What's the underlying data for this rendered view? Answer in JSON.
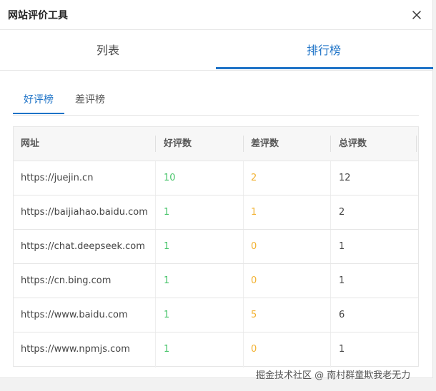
{
  "dialog": {
    "title": "网站评价工具",
    "close_icon": "close-icon"
  },
  "main_tabs": [
    {
      "label": "列表",
      "active": false
    },
    {
      "label": "排行榜",
      "active": true
    }
  ],
  "sub_tabs": [
    {
      "label": "好评榜",
      "active": true
    },
    {
      "label": "差评榜",
      "active": false
    }
  ],
  "table": {
    "headers": [
      "网址",
      "好评数",
      "差评数",
      "总评数"
    ],
    "rows": [
      {
        "url": "https://juejin.cn",
        "good": "10",
        "bad": "2",
        "total": "12"
      },
      {
        "url": "https://baijiahao.baidu.com",
        "good": "1",
        "bad": "1",
        "total": "2"
      },
      {
        "url": "https://chat.deepseek.com",
        "good": "1",
        "bad": "0",
        "total": "1"
      },
      {
        "url": "https://cn.bing.com",
        "good": "1",
        "bad": "0",
        "total": "1"
      },
      {
        "url": "https://www.baidu.com",
        "good": "1",
        "bad": "5",
        "total": "6"
      },
      {
        "url": "https://www.npmjs.com",
        "good": "1",
        "bad": "0",
        "total": "1"
      }
    ]
  },
  "colors": {
    "accent": "#1e73c7",
    "good": "#47c46a",
    "bad": "#f2b233"
  },
  "watermark": "掘金技术社区 @ 南村群童欺我老无力"
}
